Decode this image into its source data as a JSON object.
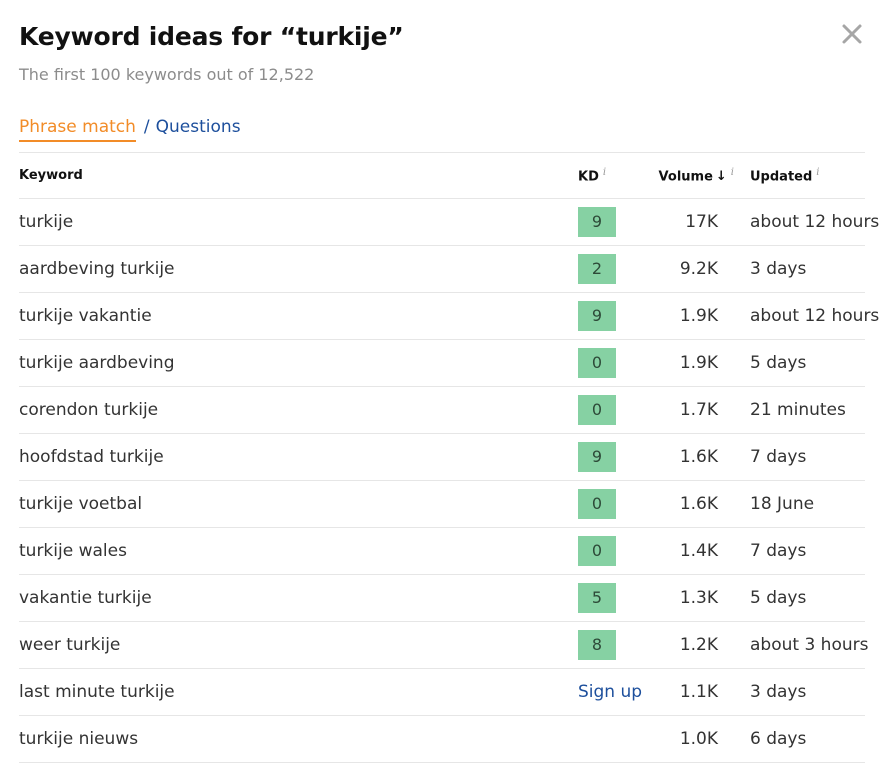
{
  "header": {
    "title": "Keyword ideas for “turkije”",
    "subtitle": "The first 100 keywords out of 12,522"
  },
  "tabs": {
    "active": "Phrase match",
    "separator": "/",
    "other": "Questions"
  },
  "table": {
    "columns": {
      "keyword": "Keyword",
      "kd": "KD",
      "volume": "Volume",
      "updated": "Updated",
      "info_marker": "i",
      "sort_arrow": "↓"
    },
    "rows": [
      {
        "keyword": "turkije",
        "kd": "9",
        "volume": "17K",
        "updated": "about 12 hours"
      },
      {
        "keyword": "aardbeving turkije",
        "kd": "2",
        "volume": "9.2K",
        "updated": "3 days"
      },
      {
        "keyword": "turkije vakantie",
        "kd": "9",
        "volume": "1.9K",
        "updated": "about 12 hours"
      },
      {
        "keyword": "turkije aardbeving",
        "kd": "0",
        "volume": "1.9K",
        "updated": "5 days"
      },
      {
        "keyword": "corendon turkije",
        "kd": "0",
        "volume": "1.7K",
        "updated": "21 minutes"
      },
      {
        "keyword": "hoofdstad turkije",
        "kd": "9",
        "volume": "1.6K",
        "updated": "7 days"
      },
      {
        "keyword": "turkije voetbal",
        "kd": "0",
        "volume": "1.6K",
        "updated": "18 June"
      },
      {
        "keyword": "turkije wales",
        "kd": "0",
        "volume": "1.4K",
        "updated": "7 days"
      },
      {
        "keyword": "vakantie turkije",
        "kd": "5",
        "volume": "1.3K",
        "updated": "5 days"
      },
      {
        "keyword": "weer turkije",
        "kd": "8",
        "volume": "1.2K",
        "updated": "about 3 hours"
      },
      {
        "keyword": "last minute turkije",
        "kd_link": "Sign up",
        "volume": "1.1K",
        "updated": "3 days"
      },
      {
        "keyword": "turkije nieuws",
        "volume": "1.0K",
        "updated": "6 days"
      }
    ]
  },
  "colors": {
    "accent_tab": "#f28c28",
    "link": "#1d4f9c",
    "kd_badge": "#86d1a3"
  },
  "icons": {
    "close": "close-icon",
    "info": "info-icon",
    "sort": "sort-desc-icon"
  }
}
